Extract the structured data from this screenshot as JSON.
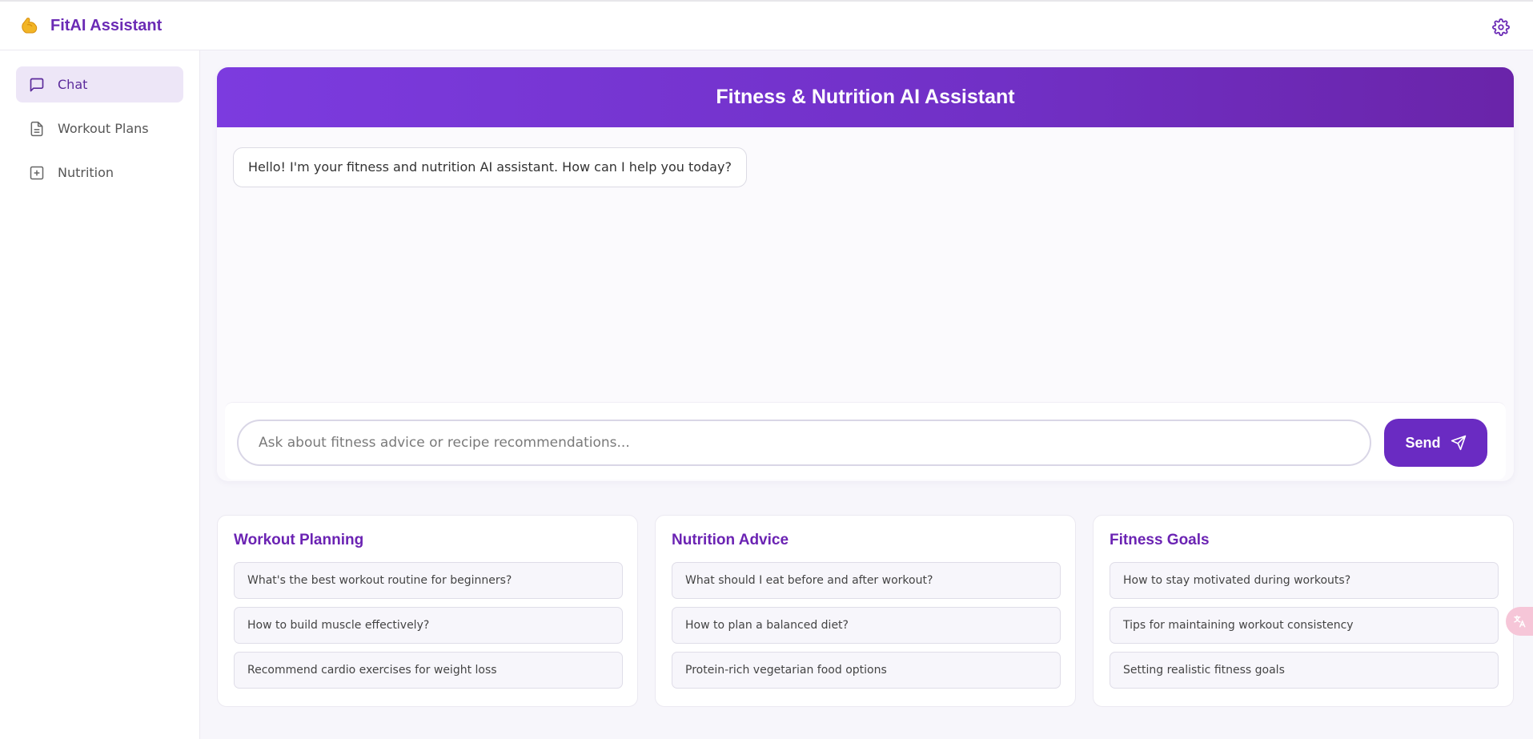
{
  "app": {
    "name": "FitAI Assistant",
    "logo_icon": "flexed-biceps-icon"
  },
  "sidebar": {
    "items": [
      {
        "label": "Chat",
        "icon": "chat-bubble-icon",
        "active": true
      },
      {
        "label": "Workout Plans",
        "icon": "document-icon",
        "active": false
      },
      {
        "label": "Nutrition",
        "icon": "plus-square-icon",
        "active": false
      }
    ]
  },
  "chat": {
    "title": "Fitness & Nutrition AI Assistant",
    "messages": [
      {
        "role": "assistant",
        "text": "Hello! I'm your fitness and nutrition AI assistant. How can I help you today?"
      }
    ],
    "input": {
      "placeholder": "Ask about fitness advice or recipe recommendations...",
      "value": ""
    },
    "send_label": "Send"
  },
  "suggestions": [
    {
      "title": "Workout Planning",
      "items": [
        "What's the best workout routine for beginners?",
        "How to build muscle effectively?",
        "Recommend cardio exercises for weight loss"
      ]
    },
    {
      "title": "Nutrition Advice",
      "items": [
        "What should I eat before and after workout?",
        "How to plan a balanced diet?",
        "Protein-rich vegetarian food options"
      ]
    },
    {
      "title": "Fitness Goals",
      "items": [
        "How to stay motivated during workouts?",
        "Tips for maintaining workout consistency",
        "Setting realistic fitness goals"
      ]
    }
  ],
  "colors": {
    "brand": "#6b2bb5",
    "header_gradient_start": "#7c3bdf",
    "header_gradient_end": "#6a24a9",
    "send_button": "#6a2bc2",
    "active_nav_bg": "#ede6f7"
  },
  "floating_tab": {
    "icon": "translate-icon"
  }
}
